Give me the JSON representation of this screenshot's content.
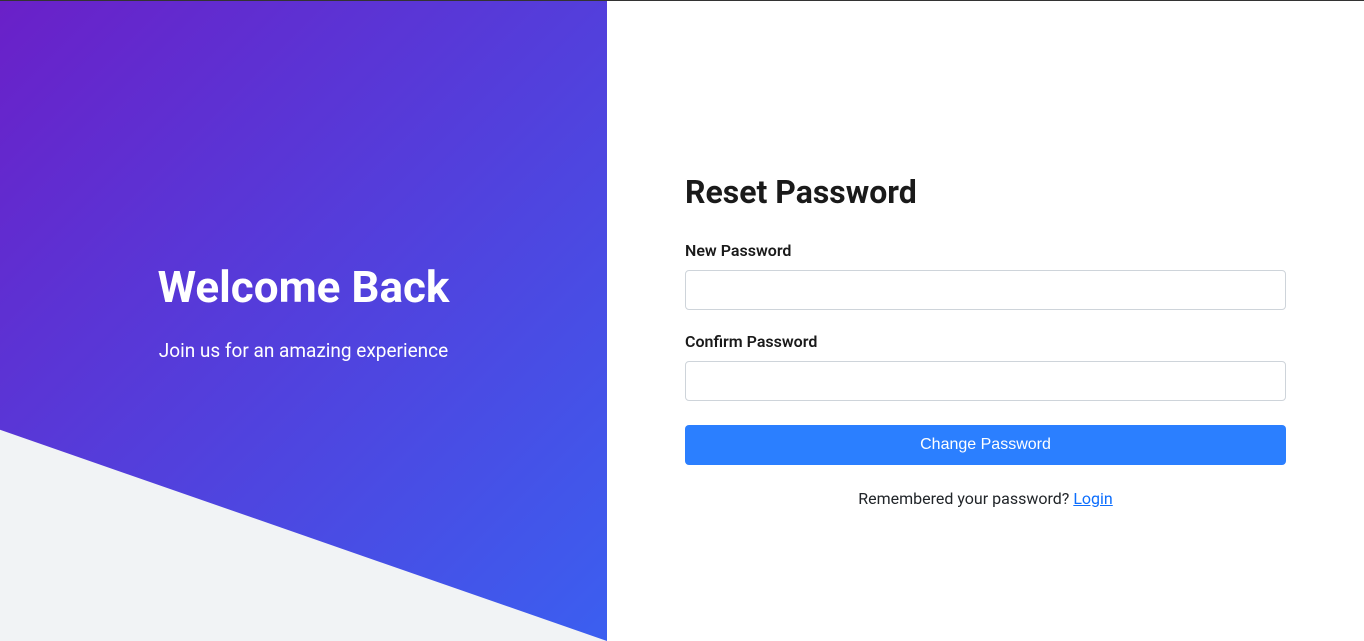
{
  "left": {
    "title": "Welcome Back",
    "subtitle": "Join us for an amazing experience"
  },
  "form": {
    "title": "Reset Password",
    "new_password_label": "New Password",
    "confirm_password_label": "Confirm Password",
    "submit_label": "Change Password"
  },
  "footer": {
    "text": "Remembered your password? ",
    "link_label": "Login"
  }
}
